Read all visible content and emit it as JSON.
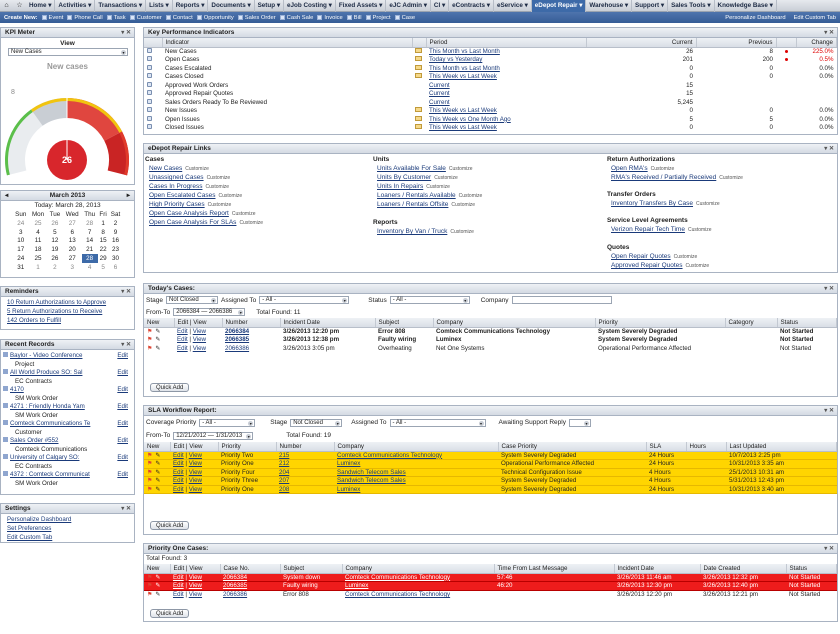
{
  "nav": {
    "tabs": [
      "Home",
      "Activities",
      "Transactions",
      "Lists",
      "Reports",
      "Documents",
      "Setup",
      "eJob Costing",
      "Fixed Assets",
      "eJC Admin",
      "CI",
      "eContracts",
      "eService",
      "eDepot Repair",
      "Warehouse",
      "Support",
      "Sales Tools",
      "Knowledge Base"
    ],
    "active": "eDepot Repair"
  },
  "create_new": {
    "label": "Create New:",
    "items": [
      "Event",
      "Phone Call",
      "Task",
      "Customer",
      "Contact",
      "Opportunity",
      "Sales Order",
      "Cash Sale",
      "Invoice",
      "Bill",
      "Project",
      "Case"
    ],
    "right": [
      "Personalize Dashboard",
      "Edit Custom Tab"
    ]
  },
  "kpi_meter": {
    "title": "KPI Meter",
    "view_label": "View",
    "view_value": "New Cases",
    "gauge_title": "New cases",
    "gauge_value": "26",
    "gauge_tick": "8",
    "gauge_fraction": 0.5
  },
  "calendar": {
    "title": "March 2013",
    "today": "Today: March 28, 2013",
    "days": [
      "Sun",
      "Mon",
      "Tue",
      "Wed",
      "Thu",
      "Fri",
      "Sat"
    ],
    "weeks": [
      [
        "24",
        "25",
        "26",
        "27",
        "28",
        "1",
        "2"
      ],
      [
        "3",
        "4",
        "5",
        "6",
        "7",
        "8",
        "9"
      ],
      [
        "10",
        "11",
        "12",
        "13",
        "14",
        "15",
        "16"
      ],
      [
        "17",
        "18",
        "19",
        "20",
        "21",
        "22",
        "23"
      ],
      [
        "24",
        "25",
        "26",
        "27",
        "28",
        "29",
        "30"
      ],
      [
        "31",
        "1",
        "2",
        "3",
        "4",
        "5",
        "6"
      ]
    ]
  },
  "reminders": {
    "title": "Reminders",
    "items": [
      "10 Return Authorizations to Approve",
      "5 Return Authorizations to Receive",
      "142 Orders to Fulfill"
    ]
  },
  "recent": {
    "title": "Recent Records",
    "edit": "Edit",
    "items": [
      {
        "name": "Baylor - Video Conference",
        "sub": "Project"
      },
      {
        "name": "All World Produce SO: Sal",
        "sub": "EC Contracts"
      },
      {
        "name": "4170",
        "sub": "SM Work Order"
      },
      {
        "name": "4271 : Friendly Honda Yam",
        "sub": "SM Work Order"
      },
      {
        "name": "Comteck Communications Te",
        "sub": "Customer"
      },
      {
        "name": "Sales Order #552",
        "sub": "Comteck Communications"
      },
      {
        "name": "University of Calgary SO:",
        "sub": "EC Contracts"
      },
      {
        "name": "4372 : Comteck Communicat",
        "sub": "SM Work Order"
      }
    ]
  },
  "settings": {
    "title": "Settings",
    "items": [
      "Personalize Dashboard",
      "Set Preferences",
      "Edit Custom Tab"
    ]
  },
  "kpi": {
    "title": "Key Performance Indicators",
    "cols": [
      "Indicator",
      "Period",
      "Current",
      "Previous",
      "Change"
    ],
    "rows": [
      {
        "ind": "New Cases",
        "per": "This Month vs Last Month",
        "cur": "26",
        "prev": "8",
        "chg": "225.0%",
        "dot": true,
        "has_chart": true
      },
      {
        "ind": "Open Cases",
        "per": "Today vs Yesterday",
        "cur": "201",
        "prev": "200",
        "chg": "0.5%",
        "dot": true,
        "has_chart": true
      },
      {
        "ind": "Cases Escalated",
        "per": "This Month vs Last Month",
        "cur": "0",
        "prev": "0",
        "chg": "0.0%",
        "dot": false,
        "has_chart": true
      },
      {
        "ind": "Cases Closed",
        "per": "This Week vs Last Week",
        "cur": "0",
        "prev": "0",
        "chg": "0.0%",
        "dot": false,
        "has_chart": true
      },
      {
        "ind": "Approved Work Orders",
        "per": "Current",
        "cur": "15",
        "prev": "",
        "chg": "",
        "dot": false,
        "has_chart": false
      },
      {
        "ind": "Approved Repair Quotes",
        "per": "Current",
        "cur": "15",
        "prev": "",
        "chg": "",
        "dot": false,
        "has_chart": false
      },
      {
        "ind": "Sales Orders Ready To Be Reviewed",
        "per": "Current",
        "cur": "5,245",
        "prev": "",
        "chg": "",
        "dot": false,
        "has_chart": false
      },
      {
        "ind": "New Issues",
        "per": "This Week vs Last Week",
        "cur": "0",
        "prev": "0",
        "chg": "0.0%",
        "dot": false,
        "has_chart": true
      },
      {
        "ind": "Open Issues",
        "per": "This Week vs One Month Ago",
        "cur": "5",
        "prev": "5",
        "chg": "0.0%",
        "dot": false,
        "has_chart": true
      },
      {
        "ind": "Closed Issues",
        "per": "This Week vs Last Week",
        "cur": "0",
        "prev": "0",
        "chg": "0.0%",
        "dot": false,
        "has_chart": true
      }
    ]
  },
  "links": {
    "title": "eDepot Repair Links",
    "customize": "Customize",
    "cases": {
      "title": "Cases",
      "items": [
        "New Cases",
        "Unassigned Cases",
        "Cases In Progress",
        "Open Escalated Cases",
        "High Priority Cases",
        "Open Case Analysis Report",
        "Open Case Analysis For SLAs"
      ]
    },
    "units": {
      "title": "Units",
      "items": [
        "Units Available For Sale",
        "Units By Customer",
        "Units In Repairs",
        "Loaners / Rentals Available",
        "Loaners / Rentals Offsite"
      ]
    },
    "reports": {
      "title": "Reports",
      "items": [
        "Inventory By Van / Truck"
      ]
    },
    "ra": {
      "title": "Return Authorizations",
      "items": [
        "Open RMA's",
        "RMA's Received / Partially Received"
      ]
    },
    "to": {
      "title": "Transfer Orders",
      "items": [
        "Inventory Transfers By Case"
      ]
    },
    "sla": {
      "title": "Service Level Agreements",
      "items": [
        "Verizon Repair Tech Time"
      ]
    },
    "quotes": {
      "title": "Quotes",
      "items": [
        "Open Repair Quotes",
        "Approved Repair Quotes"
      ]
    }
  },
  "today": {
    "title": "Today's Cases:",
    "stage_label": "Stage",
    "stage": "Not Closed",
    "assigned_label": "Assigned To",
    "assigned": "- All -",
    "status_label": "Status",
    "status": "- All -",
    "company_label": "Company",
    "fromto_label": "From-To",
    "fromto": "2066384 — 2066386",
    "total": "Total Found: 11",
    "quick_add": "Quick Add",
    "cols": [
      "New",
      "Edit | View",
      "Number",
      "Incident Date",
      "Subject",
      "Company",
      "Priority",
      "Category",
      "Status"
    ],
    "rows": [
      {
        "num": "2066384",
        "date": "3/26/2013 12:20 pm",
        "subj": "Error 808",
        "comp": "Comteck Communications Technology",
        "pri": "System Severely Degraded",
        "cat": "",
        "st": "Not Started",
        "bold": true
      },
      {
        "num": "2066385",
        "date": "3/26/2013 12:38 pm",
        "subj": "Faulty wiring",
        "comp": "Luminex",
        "pri": "System Severely Degraded",
        "cat": "",
        "st": "Not Started",
        "bold": true
      },
      {
        "num": "2066386",
        "date": "3/26/2013 3:05 pm",
        "subj": "Overheating",
        "comp": "Net One Systems",
        "pri": "Operational Performance Affected",
        "cat": "",
        "st": "Not Started",
        "bold": false
      }
    ]
  },
  "sla_wf": {
    "title": "SLA Workflow Report:",
    "cov_label": "Coverage Priority",
    "cov": "- All -",
    "stage_label": "Stage",
    "stage": "Not Closed",
    "assigned_label": "Assigned To",
    "assigned": "- All -",
    "await_label": "Awaiting Support Reply",
    "fromto_label": "From-To",
    "fromto": "12/21/2012 — 1/31/2013",
    "total": "Total Found: 19",
    "quick_add": "Quick Add",
    "cols": [
      "New",
      "Edit | View",
      "Priority",
      "Number",
      "Company",
      "Case Priority",
      "SLA",
      "Hours",
      "Last Updated"
    ],
    "rows": [
      {
        "pri": "Priority Two",
        "num": "215",
        "comp": "Comteck Communications Technology",
        "cp": "System Severely Degraded",
        "sla": "24 Hours",
        "hrs": "",
        "upd": "10/7/2013 2:25 pm"
      },
      {
        "pri": "Priority One",
        "num": "212",
        "comp": "Luminex",
        "cp": "Operational Performance Affected",
        "sla": "24 Hours",
        "hrs": "",
        "upd": "10/31/2013 3:35 am"
      },
      {
        "pri": "Priority Four",
        "num": "204",
        "comp": "Sandwich Telecom Sales",
        "cp": "Technical Configuration Issue",
        "sla": "4 Hours",
        "hrs": "",
        "upd": "25/1/2013 10:31 am"
      },
      {
        "pri": "Priority Three",
        "num": "207",
        "comp": "Sandwich Telecom Sales",
        "cp": "System Severely Degraded",
        "sla": "4 Hours",
        "hrs": "",
        "upd": "5/31/2013 12:43 pm"
      },
      {
        "pri": "Priority One",
        "num": "208",
        "comp": "Luminex",
        "cp": "System Severely Degraded",
        "sla": "24 Hours",
        "hrs": "",
        "upd": "10/31/2013 3:40 am"
      }
    ]
  },
  "p1": {
    "title": "Priority One Cases:",
    "total": "Total Found: 3",
    "quick_add": "Quick Add",
    "cols": [
      "New",
      "Edit | View",
      "Case No.",
      "Subject",
      "Company",
      "Time From Last Message",
      "Incident Date",
      "Date Created",
      "Status"
    ],
    "rows": [
      {
        "num": "2066384",
        "subj": "System down",
        "comp": "Comteck Communications Technology",
        "tlm": "57:46",
        "inc": "3/26/2013 11:46 am",
        "dc": "3/26/2013 12:32 pm",
        "st": "Not Started",
        "red": true
      },
      {
        "num": "2066385",
        "subj": "Faulty wiring",
        "comp": "Luminex",
        "tlm": "46:20",
        "inc": "3/26/2013 12:30 pm",
        "dc": "3/26/2013 12:40 pm",
        "st": "Not Started",
        "red": true
      },
      {
        "num": "2066386",
        "subj": "Error 808",
        "comp": "Comteck Communications Technology",
        "tlm": "",
        "inc": "3/26/2013 12:20 pm",
        "dc": "3/26/2013 12:21 pm",
        "st": "Not Started",
        "red": false
      }
    ]
  },
  "colors": {
    "accent": "#3d6aa8",
    "gauge_red": "#d8262c",
    "yellow_row": "#ffd500",
    "red_row": "#ee1c1c"
  }
}
